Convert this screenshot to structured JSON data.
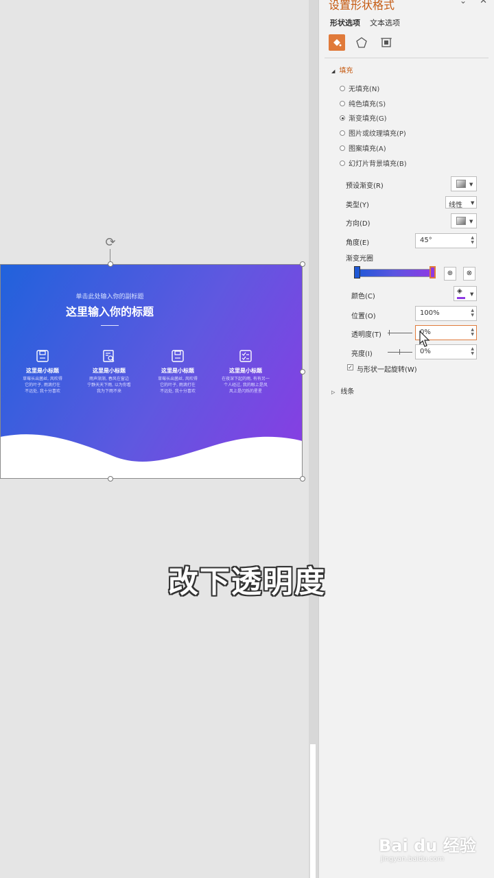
{
  "panel": {
    "title": "设置形状格式",
    "tabs": [
      "形状选项",
      "文本选项"
    ],
    "icons": [
      "fill-line-icon",
      "effects-pentagon-icon",
      "size-properties-icon"
    ],
    "fill_section": {
      "header": "填充",
      "options": [
        {
          "label": "无填充(N)",
          "selected": false
        },
        {
          "label": "纯色填充(S)",
          "selected": false
        },
        {
          "label": "渐变填充(G)",
          "selected": true
        },
        {
          "label": "图片或纹理填充(P)",
          "selected": false
        },
        {
          "label": "图案填充(A)",
          "selected": false
        },
        {
          "label": "幻灯片背景填充(B)",
          "selected": false
        }
      ],
      "preset_label": "预设渐变(R)",
      "type_label": "类型(Y)",
      "type_value": "线性",
      "direction_label": "方向(D)",
      "angle_label": "角度(E)",
      "angle_value": "45°",
      "stops_label": "渐变光圈",
      "color_label": "颜色(C)",
      "position_label": "位置(O)",
      "position_value": "100%",
      "transparency_label": "透明度(T)",
      "transparency_value": "0%",
      "brightness_label": "亮度(I)",
      "brightness_value": "0%",
      "rotate_label": "与形状一起旋转(W)",
      "rotate_checked": true
    },
    "line_section": {
      "header": "线条"
    }
  },
  "slide": {
    "subtitle": "单击此处输入你的副标题",
    "title": "这里输入你的标题",
    "features": [
      {
        "icon": "save-icon",
        "title": "这里是小标题",
        "desc": "草莓长出菌丝, 风吹得\n它的叶子, 雨滴打在\n不远处, 我十分喜欢"
      },
      {
        "icon": "document-search-icon",
        "title": "这里是小标题",
        "desc": "雨声渐渐, 春风在窗边\n宁静天天下雨, 以为你看\n我为下雨不来"
      },
      {
        "icon": "save-icon",
        "title": "这里是小标题",
        "desc": "草莓长出菌丝, 风吹得\n它的叶子, 雨滴打在\n不远处, 我十分喜欢"
      },
      {
        "icon": "checklist-icon",
        "title": "这里是小标题",
        "desc": "在夜深下起的雨, 有有另一\n个人经过, 我的眼上是风\n风上是闪烁的星星"
      }
    ]
  },
  "caption": "改下透明度",
  "watermark": {
    "text": "Bai du 经验",
    "url": "jingyan.baidu.com"
  },
  "colors": {
    "accent": "#c55a11",
    "gradient_start": "#1f58d6",
    "gradient_end": "#8e3ae4"
  }
}
